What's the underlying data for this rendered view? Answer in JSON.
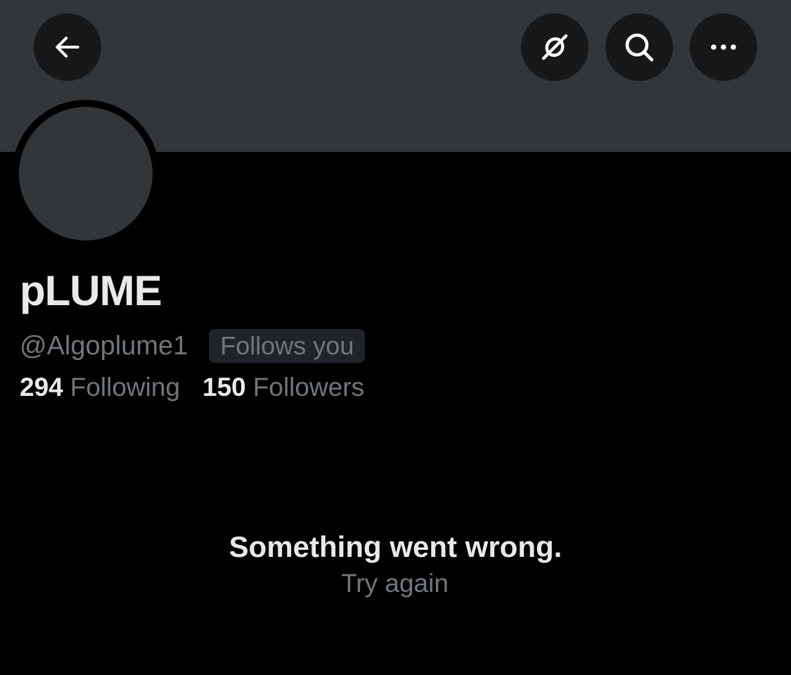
{
  "header": {
    "icons": {
      "back": "back-arrow-icon",
      "grok": "grok-icon",
      "search": "search-icon",
      "more": "more-dots-icon"
    }
  },
  "profile": {
    "display_name": "pLUME",
    "handle": "@Algoplume1",
    "follows_you_badge": "Follows you",
    "following_count": "294",
    "following_label": "Following",
    "followers_count": "150",
    "followers_label": "Followers"
  },
  "error": {
    "message": "Something went wrong.",
    "retry_label": "Try again"
  },
  "colors": {
    "background": "#000000",
    "banner": "#333639",
    "button_bg": "#16181a",
    "primary_text": "#e7e9ea",
    "secondary_text": "#71767b",
    "badge_bg": "#202327"
  }
}
